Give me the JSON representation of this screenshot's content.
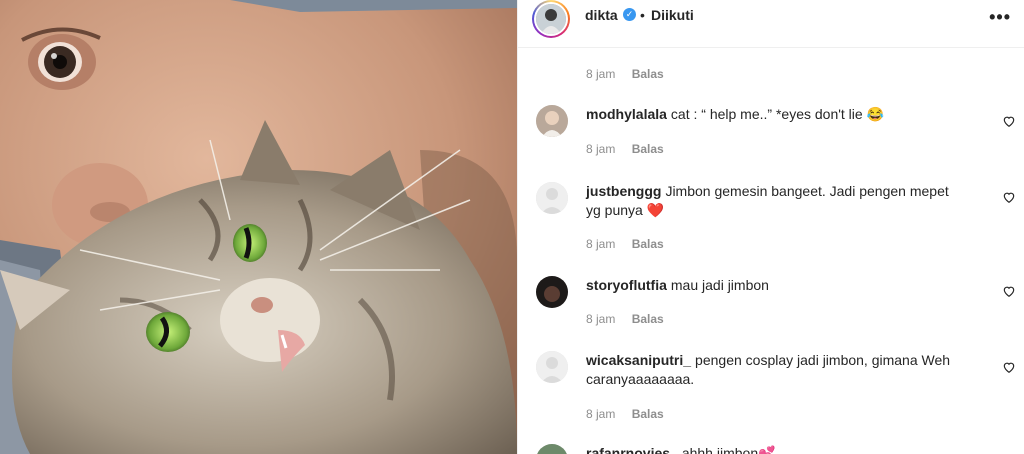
{
  "post": {
    "author": "dikta",
    "follow_status": "Diikuti",
    "separator": "•",
    "more_icon": "more-options-icon"
  },
  "first_meta": {
    "time": "8 jam",
    "reply": "Balas"
  },
  "comments": [
    {
      "username": "modhylalala",
      "text": "cat : “ help me..” *eyes don't lie 😂",
      "time": "8 jam",
      "reply": "Balas"
    },
    {
      "username": "justbenggg",
      "text": "Jimbon gemesin bangeet. Jadi pengen mepet yg punya ❤️",
      "time": "8 jam",
      "reply": "Balas"
    },
    {
      "username": "storyoflutfia",
      "text": "mau jadi jimbon",
      "time": "8 jam",
      "reply": "Balas"
    },
    {
      "username": "wicaksaniputri_",
      "text": "pengen cosplay jadi jimbon, gimana Weh caranyaaaaaaaa.",
      "time": "8 jam",
      "reply": "Balas"
    },
    {
      "username": "rafanrnovies_",
      "text": "ahhh jimbon💕",
      "time": "",
      "reply": ""
    }
  ],
  "colors": {
    "accent": "#3897f0",
    "like": "#ed4956",
    "muted": "#8e8e8e"
  }
}
